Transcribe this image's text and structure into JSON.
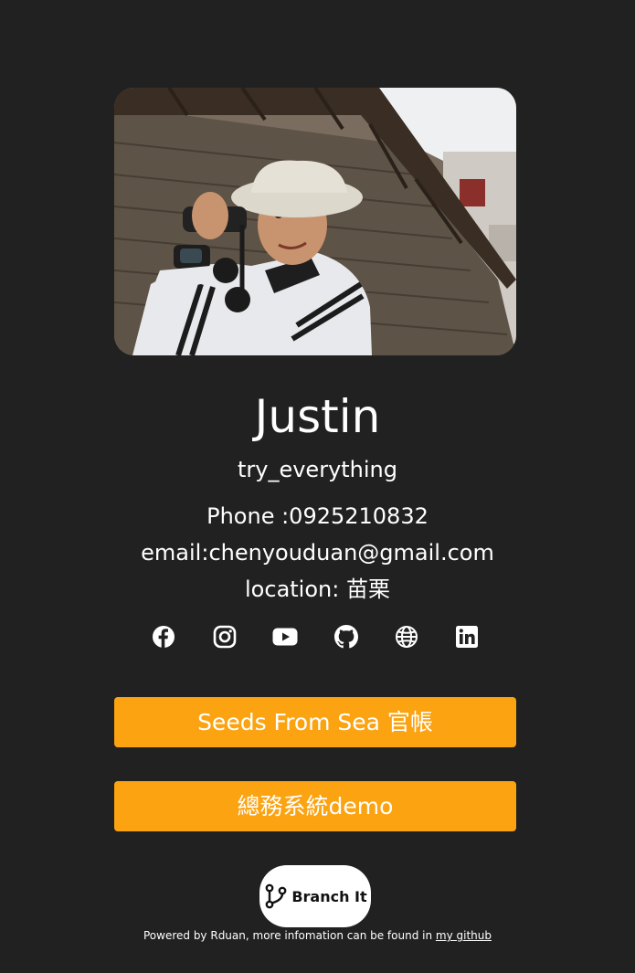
{
  "profile": {
    "name": "Justin",
    "tagline": "try_everything",
    "phone_label": "Phone :",
    "phone": "0925210832",
    "email_label": "email:",
    "email": "chenyouduan@gmail.com",
    "location_label": "location: ",
    "location": "苗栗"
  },
  "socials": [
    {
      "icon": "facebook-icon"
    },
    {
      "icon": "instagram-icon"
    },
    {
      "icon": "youtube-icon"
    },
    {
      "icon": "github-icon"
    },
    {
      "icon": "globe-icon"
    },
    {
      "icon": "linkedin-icon"
    }
  ],
  "links": [
    {
      "label": "Seeds From Sea 官帳"
    },
    {
      "label": "總務系統demo"
    }
  ],
  "brand": {
    "logo_text": "Branch It"
  },
  "footer": {
    "text": "Powered by Rduan, more infomation can be found in ",
    "link_label": "my github"
  },
  "colors": {
    "background": "#212121",
    "button": "#fba311",
    "text": "#ffffff"
  }
}
